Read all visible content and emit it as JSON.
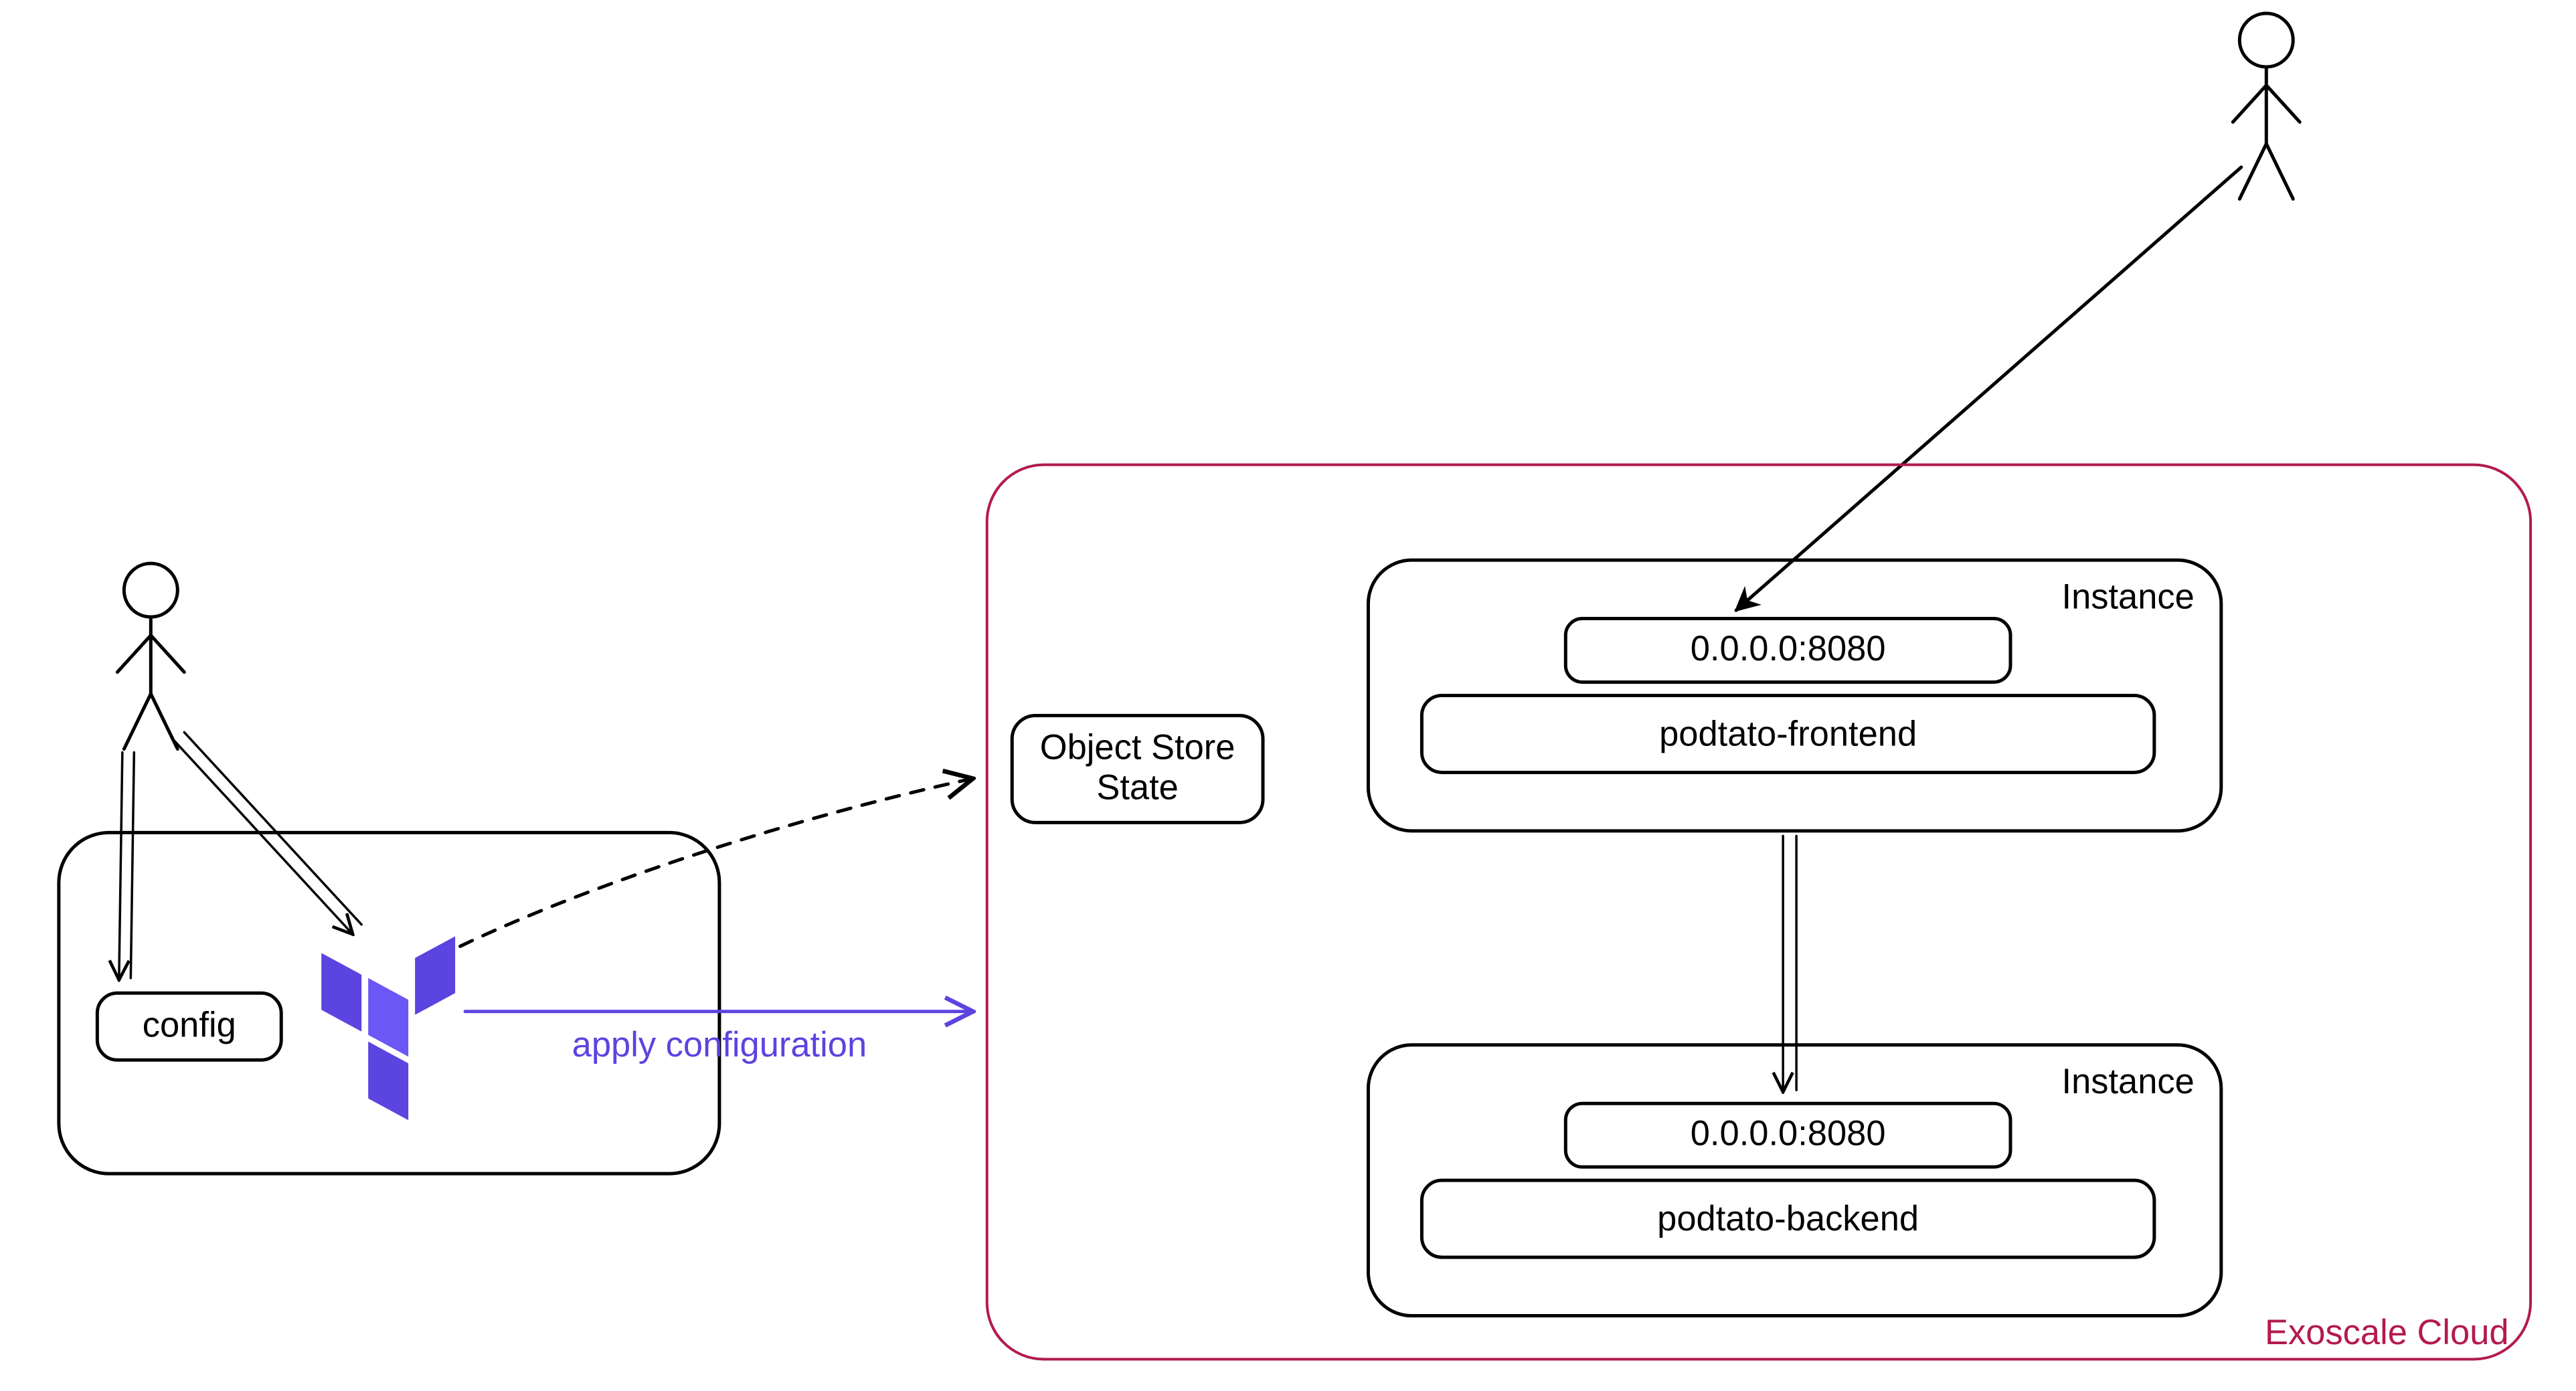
{
  "actors": {
    "left": "operator",
    "right": "user"
  },
  "local_box": {
    "config_label": "config",
    "tool_name": "terraform"
  },
  "arrows": {
    "apply_label": "apply configuration"
  },
  "cloud": {
    "provider_label": "Exoscale Cloud",
    "object_store_label_line1": "Object Store",
    "object_store_label_line2": "State",
    "instance_label": "Instance",
    "frontend": {
      "endpoint": "0.0.0.0:8080",
      "name": "podtato-frontend"
    },
    "backend": {
      "endpoint": "0.0.0.0:8080",
      "name": "podtato-backend"
    }
  },
  "colors": {
    "accent": "#5b44e0",
    "cloud_border": "#b31b4b"
  }
}
